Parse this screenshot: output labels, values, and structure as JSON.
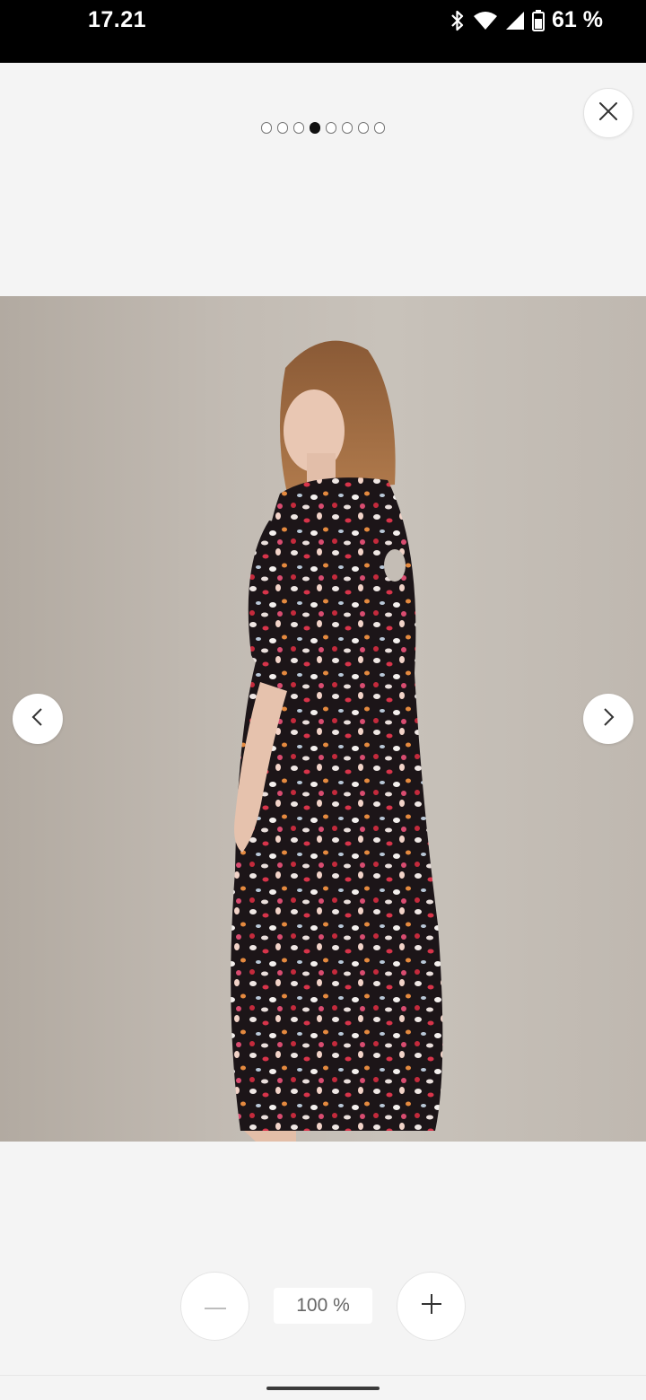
{
  "status_bar": {
    "time": "17.21",
    "battery_text": "61 %",
    "icons": [
      "bluetooth-icon",
      "wifi-icon",
      "cellular-signal-icon",
      "battery-icon"
    ]
  },
  "viewer": {
    "close_icon": "close-icon",
    "pagination": {
      "total": 8,
      "active_index": 3
    },
    "photo": {
      "subject": "product-image",
      "background_color": "#c3bcb4"
    },
    "prev_icon": "chevron-left-icon",
    "next_icon": "chevron-right-icon"
  },
  "zoom_controls": {
    "zoom_out_icon": "minus-icon",
    "zoom_in_icon": "plus-icon",
    "level": "100 %"
  },
  "colors": {
    "background": "#f4f4f4",
    "status_bar": "#000000",
    "active_dot": "#111111"
  }
}
